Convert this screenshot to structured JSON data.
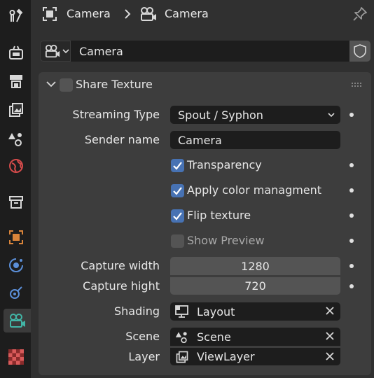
{
  "breadcrumb": {
    "object": "Camera",
    "data": "Camera"
  },
  "datablock": {
    "name": "Camera"
  },
  "panel": {
    "title": "Share Texture",
    "enabled": false
  },
  "fields": {
    "streaming_type": {
      "label": "Streaming Type",
      "value": "Spout / Syphon"
    },
    "sender_name": {
      "label": "Sender name",
      "value": "Camera"
    },
    "transparency": {
      "label": "Transparency",
      "checked": true
    },
    "apply_color": {
      "label": "Apply color managment",
      "checked": true
    },
    "flip_texture": {
      "label": "Flip texture",
      "checked": true
    },
    "show_preview": {
      "label": "Show Preview",
      "checked": false
    },
    "capture_width": {
      "label": "Capture width",
      "value": "1280"
    },
    "capture_hight": {
      "label": "Capture hight",
      "value": "720"
    },
    "shading": {
      "label": "Shading",
      "value": "Layout"
    },
    "scene": {
      "label": "Scene",
      "value": "Scene"
    },
    "layer": {
      "label": "Layer",
      "value": "ViewLayer"
    }
  },
  "tabs": [
    "tool-icon",
    "render-icon",
    "output-icon",
    "view-layer-icon",
    "scene-icon",
    "world-icon",
    "collection-icon",
    "object-icon",
    "physics-icon",
    "constraints-icon",
    "camera-data-icon",
    "texture-icon"
  ],
  "colors": {
    "accent": "#4772b3",
    "active_tab": "#42b5a6",
    "object_orange": "#d9843a"
  }
}
